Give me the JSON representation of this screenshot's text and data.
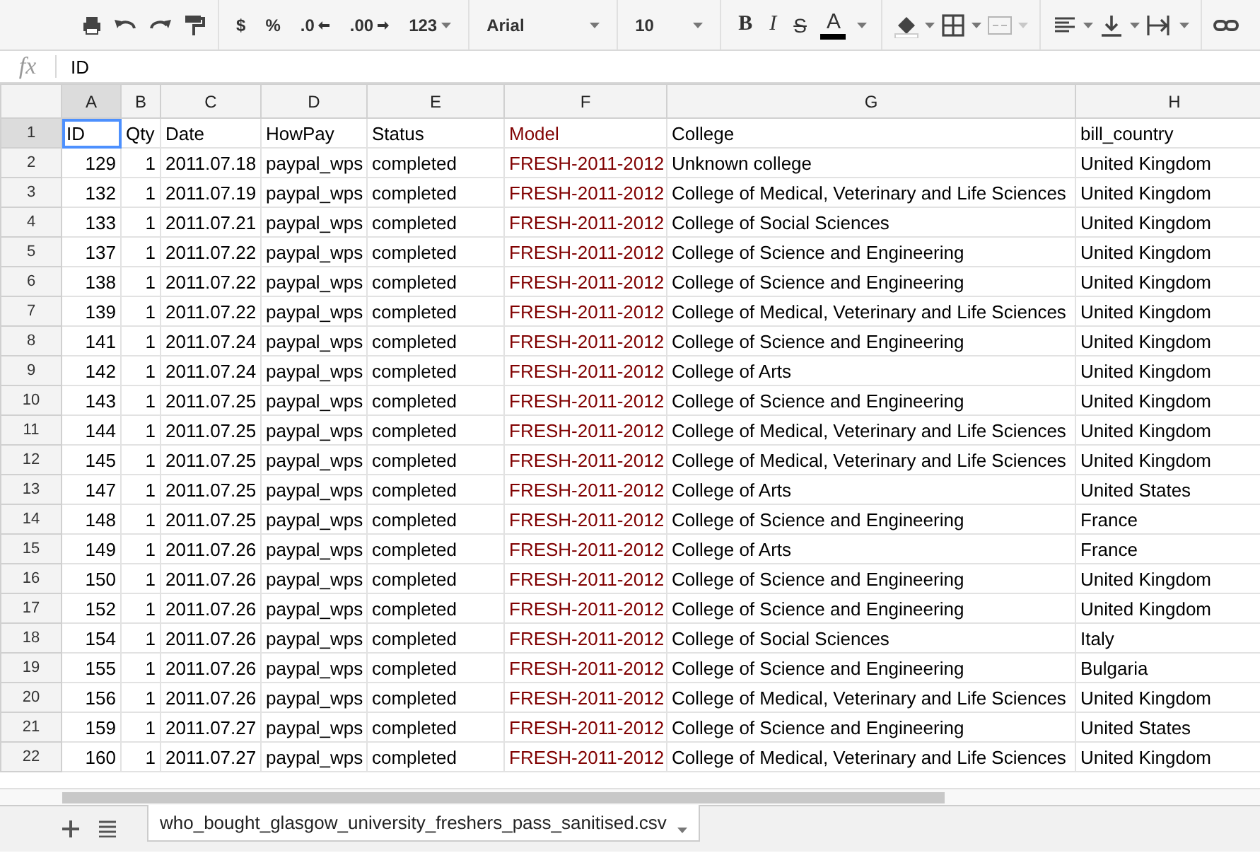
{
  "toolbar": {
    "currency": "$",
    "percent": "%",
    "decrease_decimals": ".0",
    "increase_decimals": ".00",
    "more_formats": "123",
    "font": "Arial",
    "font_size": "10",
    "bold": "B",
    "italic": "I",
    "strikethrough": "S",
    "text_color": "A",
    "merge_cells": {
      "disabled": true
    }
  },
  "formula_bar": {
    "fx": "fx",
    "value": "ID"
  },
  "columns": [
    {
      "letter": "A",
      "kind": "number",
      "selected": true
    },
    {
      "letter": "B",
      "kind": "number",
      "selected": false
    },
    {
      "letter": "C",
      "kind": "text",
      "selected": false
    },
    {
      "letter": "D",
      "kind": "text",
      "selected": false
    },
    {
      "letter": "E",
      "kind": "text",
      "selected": false
    },
    {
      "letter": "F",
      "kind": "text",
      "selected": false,
      "color": "#800000"
    },
    {
      "letter": "G",
      "kind": "text",
      "selected": false
    },
    {
      "letter": "H",
      "kind": "text",
      "selected": false
    }
  ],
  "rows": [
    {
      "n": "1",
      "kind": "header",
      "selected": true,
      "cells": [
        "ID",
        "Qty",
        "Date",
        "HowPay",
        "Status",
        "Model",
        "College",
        "bill_country"
      ]
    },
    {
      "n": "2",
      "selected": false,
      "cells": [
        "129",
        "1",
        "2011.07.18",
        "paypal_wps",
        "completed",
        "FRESH-2011-2012",
        "Unknown college",
        "United Kingdom"
      ]
    },
    {
      "n": "3",
      "selected": false,
      "cells": [
        "132",
        "1",
        "2011.07.19",
        "paypal_wps",
        "completed",
        "FRESH-2011-2012",
        "College of Medical, Veterinary and Life Sciences",
        "United Kingdom"
      ]
    },
    {
      "n": "4",
      "selected": false,
      "cells": [
        "133",
        "1",
        "2011.07.21",
        "paypal_wps",
        "completed",
        "FRESH-2011-2012",
        "College of Social Sciences",
        "United Kingdom"
      ]
    },
    {
      "n": "5",
      "selected": false,
      "cells": [
        "137",
        "1",
        "2011.07.22",
        "paypal_wps",
        "completed",
        "FRESH-2011-2012",
        "College of Science and Engineering",
        "United Kingdom"
      ]
    },
    {
      "n": "6",
      "selected": false,
      "cells": [
        "138",
        "1",
        "2011.07.22",
        "paypal_wps",
        "completed",
        "FRESH-2011-2012",
        "College of Science and Engineering",
        "United Kingdom"
      ]
    },
    {
      "n": "7",
      "selected": false,
      "cells": [
        "139",
        "1",
        "2011.07.22",
        "paypal_wps",
        "completed",
        "FRESH-2011-2012",
        "College of Medical, Veterinary and Life Sciences",
        "United Kingdom"
      ]
    },
    {
      "n": "8",
      "selected": false,
      "cells": [
        "141",
        "1",
        "2011.07.24",
        "paypal_wps",
        "completed",
        "FRESH-2011-2012",
        "College of Science and Engineering",
        "United Kingdom"
      ]
    },
    {
      "n": "9",
      "selected": false,
      "cells": [
        "142",
        "1",
        "2011.07.24",
        "paypal_wps",
        "completed",
        "FRESH-2011-2012",
        "College of Arts",
        "United Kingdom"
      ]
    },
    {
      "n": "10",
      "selected": false,
      "cells": [
        "143",
        "1",
        "2011.07.25",
        "paypal_wps",
        "completed",
        "FRESH-2011-2012",
        "College of Science and Engineering",
        "United Kingdom"
      ]
    },
    {
      "n": "11",
      "selected": false,
      "cells": [
        "144",
        "1",
        "2011.07.25",
        "paypal_wps",
        "completed",
        "FRESH-2011-2012",
        "College of Medical, Veterinary and Life Sciences",
        "United Kingdom"
      ]
    },
    {
      "n": "12",
      "selected": false,
      "cells": [
        "145",
        "1",
        "2011.07.25",
        "paypal_wps",
        "completed",
        "FRESH-2011-2012",
        "College of Medical, Veterinary and Life Sciences",
        "United Kingdom"
      ]
    },
    {
      "n": "13",
      "selected": false,
      "cells": [
        "147",
        "1",
        "2011.07.25",
        "paypal_wps",
        "completed",
        "FRESH-2011-2012",
        "College of Arts",
        "United States"
      ]
    },
    {
      "n": "14",
      "selected": false,
      "cells": [
        "148",
        "1",
        "2011.07.25",
        "paypal_wps",
        "completed",
        "FRESH-2011-2012",
        "College of Science and Engineering",
        "France"
      ]
    },
    {
      "n": "15",
      "selected": false,
      "cells": [
        "149",
        "1",
        "2011.07.26",
        "paypal_wps",
        "completed",
        "FRESH-2011-2012",
        "College of Arts",
        "France"
      ]
    },
    {
      "n": "16",
      "selected": false,
      "cells": [
        "150",
        "1",
        "2011.07.26",
        "paypal_wps",
        "completed",
        "FRESH-2011-2012",
        "College of Science and Engineering",
        "United Kingdom"
      ]
    },
    {
      "n": "17",
      "selected": false,
      "cells": [
        "152",
        "1",
        "2011.07.26",
        "paypal_wps",
        "completed",
        "FRESH-2011-2012",
        "College of Science and Engineering",
        "United Kingdom"
      ]
    },
    {
      "n": "18",
      "selected": false,
      "cells": [
        "154",
        "1",
        "2011.07.26",
        "paypal_wps",
        "completed",
        "FRESH-2011-2012",
        "College of Social Sciences",
        "Italy"
      ]
    },
    {
      "n": "19",
      "selected": false,
      "cells": [
        "155",
        "1",
        "2011.07.26",
        "paypal_wps",
        "completed",
        "FRESH-2011-2012",
        "College of Science and Engineering",
        "Bulgaria"
      ]
    },
    {
      "n": "20",
      "selected": false,
      "cells": [
        "156",
        "1",
        "2011.07.26",
        "paypal_wps",
        "completed",
        "FRESH-2011-2012",
        "College of Medical, Veterinary and Life Sciences",
        "United Kingdom"
      ]
    },
    {
      "n": "21",
      "selected": false,
      "cells": [
        "159",
        "1",
        "2011.07.27",
        "paypal_wps",
        "completed",
        "FRESH-2011-2012",
        "College of Science and Engineering",
        "United States"
      ]
    },
    {
      "n": "22",
      "selected": false,
      "cells": [
        "160",
        "1",
        "2011.07.27",
        "paypal_wps",
        "completed",
        "FRESH-2011-2012",
        "College of Medical, Veterinary and Life Sciences",
        "United Kingdom"
      ]
    }
  ],
  "sheet_tabs": [
    {
      "label": "who_bought_glasgow_university_freshers_pass_sanitised.csv",
      "selected": true
    }
  ]
}
